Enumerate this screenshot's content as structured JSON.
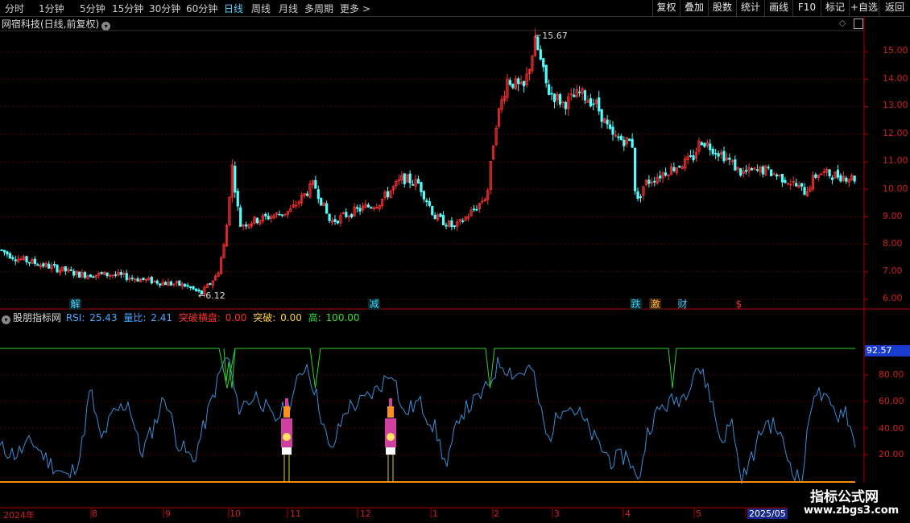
{
  "toolbar": {
    "timeframes": [
      "分时",
      "1分钟",
      "5分钟",
      "15分钟",
      "30分钟",
      "60分钟",
      "日线",
      "周线",
      "月线",
      "多周期",
      "更多 >"
    ],
    "active": "日线",
    "buttons": [
      "复权",
      "叠加",
      "股数",
      "统计",
      "画线",
      "F10",
      "标记",
      "+自选",
      "返回"
    ]
  },
  "main_panel": {
    "title": "网宿科技(日线,前复权)",
    "y_ticks": [
      "15.00",
      "14.00",
      "13.00",
      "12.00",
      "11.00",
      "10.00",
      "9.00",
      "8.00",
      "7.00",
      "6.00"
    ],
    "high_annotation": "15.67",
    "low_annotation": "6.12",
    "events": [
      {
        "label": "解",
        "color": "#3fd0ff",
        "bg": "#123"
      },
      {
        "label": "减",
        "color": "#3fd0ff",
        "bg": "#123"
      },
      {
        "label": "跌",
        "color": "#3fd0ff",
        "bg": "#123"
      },
      {
        "label": "激",
        "color": "#ffbb33",
        "bg": "#321"
      },
      {
        "label": "财",
        "color": "#3fd0ff",
        "bg": "#000"
      },
      {
        "label": "$",
        "color": "#ff3030",
        "bg": "#000"
      }
    ]
  },
  "indicator": {
    "name": "股朋指标网",
    "rsi": {
      "label": "RSI:",
      "value": "25.43",
      "color": "#4aa8ff"
    },
    "ratio": {
      "label": "量比:",
      "value": "2.41",
      "color": "#4aa8ff"
    },
    "breakout_cons": {
      "label": "突破横盘:",
      "value": "0.00",
      "color": "#ff3030"
    },
    "breakout": {
      "label": "突破:",
      "value": "0.00",
      "color": "#ffd23a"
    },
    "high": {
      "label": "高:",
      "value": "100.00",
      "color": "#38e038"
    },
    "current_tag": "92.57",
    "y_ticks": [
      "80.00",
      "60.00",
      "40.00",
      "20.00"
    ]
  },
  "x_axis": [
    "2024年",
    "8",
    "9",
    "10",
    "11",
    "12",
    "1",
    "2",
    "3",
    "4",
    "5",
    "2025/05"
  ],
  "watermark": {
    "title": "指标公式网",
    "url": "www.zbgs3.com"
  },
  "colors": {
    "up": "#ff3232",
    "down": "#54ffff",
    "rsi_line": "#3a8fd8",
    "high_line": "#30d030",
    "base_line": "#ff8c00",
    "grid": "#5a0000",
    "axis": "#b00000"
  }
}
